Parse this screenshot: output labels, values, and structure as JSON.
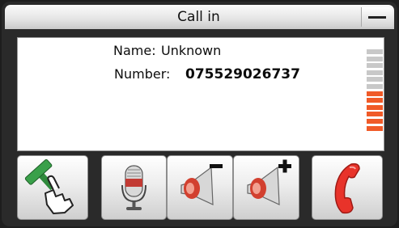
{
  "window": {
    "title": "Call in"
  },
  "caller": {
    "name_label": "Name:",
    "name_value": "Unknown",
    "number_label": "Number:",
    "number_value": "075529026737"
  },
  "signal": {
    "total_bars": 12,
    "active_bars": 6,
    "active_color": "#f05a28",
    "inactive_color": "#c8c8c8"
  },
  "buttons": [
    {
      "name": "transfer-button",
      "icon": "hand-gavel-icon"
    },
    {
      "name": "mic-button",
      "icon": "microphone-icon"
    },
    {
      "name": "volume-down-button",
      "icon": "speaker-minus-icon"
    },
    {
      "name": "volume-up-button",
      "icon": "speaker-plus-icon"
    },
    {
      "name": "hang-up-button",
      "icon": "phone-handset-icon"
    }
  ],
  "colors": {
    "accent_red": "#e8332a",
    "transfer_green": "#2f8a3c"
  }
}
